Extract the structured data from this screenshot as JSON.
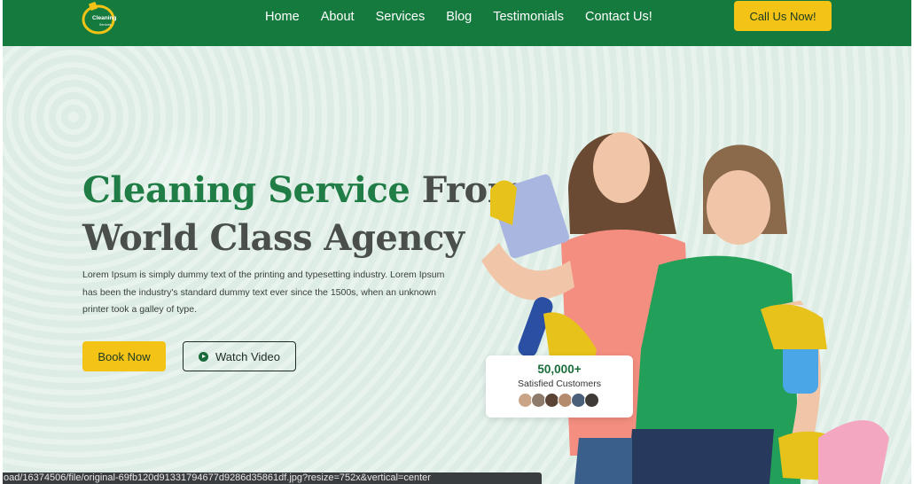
{
  "brand": {
    "logo_text": "Cleaning",
    "logo_subtext": "Services"
  },
  "nav": {
    "items": [
      "Home",
      "About",
      "Services",
      "Blog",
      "Testimonials",
      "Contact Us!"
    ],
    "cta_label": "Call Us Now!"
  },
  "hero": {
    "title_green": "Cleaning Service",
    "title_rest_line1": " From",
    "title_line2": "World Class Agency",
    "description": "Lorem Ipsum is simply dummy text of the printing and typesetting  industry. Lorem Ipsum has been the industry's standard dummy text ever since the 1500s, when an unknown printer took a galley of type.",
    "book_label": "Book Now",
    "watch_label": "Watch Video",
    "stats_number": "50,000+",
    "stats_label": "Satisfied Customers"
  },
  "status_url": "oad/16374506/file/original-69fb120d91331794677d9286d35861df.jpg?resize=752x&vertical=center",
  "colors": {
    "header_green": "#157a3e",
    "accent_yellow": "#f3c315",
    "title_green": "#1f7d45",
    "hero_bg": "#e2f0e9"
  },
  "icons": {
    "play": "play-circle-icon"
  }
}
